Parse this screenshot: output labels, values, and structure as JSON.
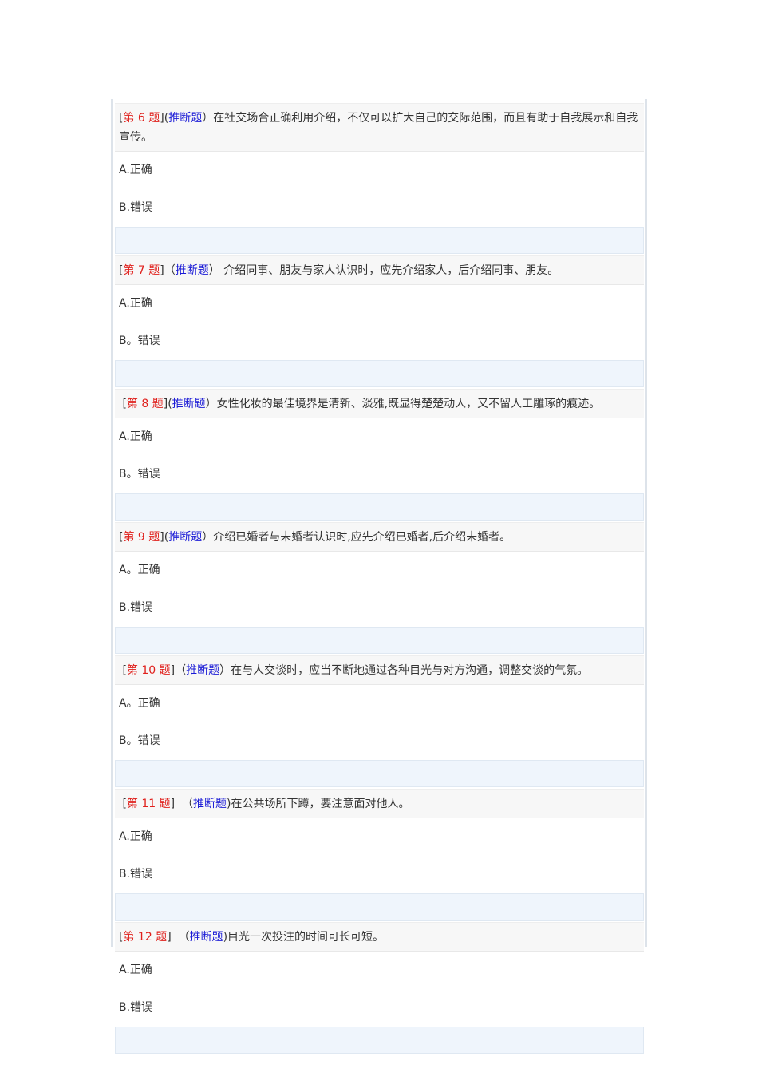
{
  "questions": [
    {
      "open": "[",
      "label": "第 6 题",
      "mid": "](",
      "type": "推断题",
      "close": "）",
      "text": "在社交场合正确利用介绍，不仅可以扩大自己的交际范围，而且有助于自我展示和自我宣传。",
      "a": "A.正确",
      "b": "B.错误"
    },
    {
      "open": "[",
      "label": "第 7 题",
      "mid": "]（",
      "type": "推断题",
      "close": "） ",
      "text": "介绍同事、朋友与家人认识时，应先介绍家人，后介绍同事、朋友。",
      "a": "A.正确",
      "b": "B。错误"
    },
    {
      "open": " [",
      "label": "第 8 题",
      "mid": "](",
      "type": "推断题",
      "close": "）",
      "text": "女性化妆的最佳境界是清新、淡雅,既显得楚楚动人，又不留人工雕琢的痕迹。",
      "a": "A.正确",
      "b": "B。错误"
    },
    {
      "open": "[",
      "label": "第 9 题",
      "mid": "](",
      "type": "推断题",
      "close": "）",
      "text": "介绍已婚者与未婚者认识时,应先介绍已婚者,后介绍未婚者。",
      "a": "A。正确",
      "b": "B.错误"
    },
    {
      "open": " [",
      "label": "第 10 题",
      "mid": "]（",
      "type": "推断题",
      "close": "）",
      "text": "在与人交谈时，应当不断地通过各种目光与对方沟通，调整交谈的气氛。",
      "a": "A。正确",
      "b": "B。错误"
    },
    {
      "open": " [",
      "label": "第 11 题",
      "mid": "]  （",
      "type": "推断题",
      "close": ")",
      "text": "在公共场所下蹲，要注意面对他人。",
      "a": "A.正确",
      "b": "B.错误"
    },
    {
      "open": "[",
      "label": "第 12 题",
      "mid": "]  （",
      "type": "推断题",
      "close": ")",
      "text": "目光一次投注的时间可长可短。",
      "a": "A.正确",
      "b": "B.错误"
    }
  ]
}
